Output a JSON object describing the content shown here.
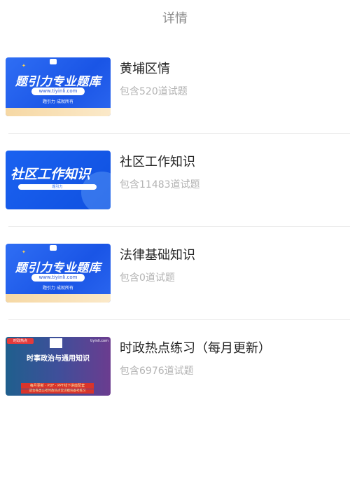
{
  "header": {
    "title": "详情"
  },
  "items": [
    {
      "name": "黄埔区情",
      "count": "包含520道试题",
      "thumb": {
        "headline": "题引力专业题库",
        "url": "www.tiyinli.com",
        "subline": "题引力 成就所有"
      }
    },
    {
      "name": "社区工作知识",
      "count": "包含11483道试题",
      "thumb": {
        "headline": "社区工作知识",
        "subline": "题引力"
      }
    },
    {
      "name": "法律基础知识",
      "count": "包含0道试题",
      "thumb": {
        "headline": "题引力专业题库",
        "url": "www.tiyinli.com",
        "subline": "题引力 成就所有"
      }
    },
    {
      "name": "时政热点练习（每月更新）",
      "count": "包含6976道试题",
      "thumb": {
        "tag": "时政热点",
        "site": "tiyinli.com",
        "headline": "时事政治与通用知识",
        "line1": "每月更新 · PDF · PPT线下讲座配套",
        "line2": "适合各类公考时政热点常识模块备考练习"
      }
    }
  ]
}
